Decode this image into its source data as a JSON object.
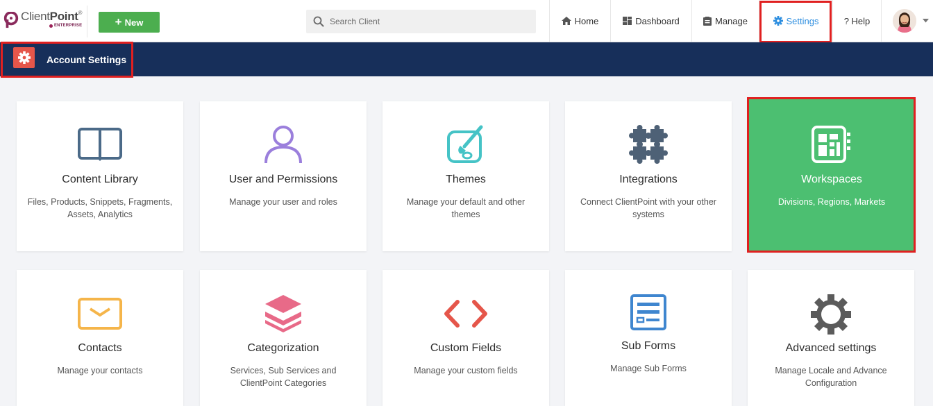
{
  "app": {
    "logo_name_light": "Client",
    "logo_name_bold": "Point",
    "logo_trademark": "®",
    "logo_sub": "ENTERPRISE",
    "new_button": "New",
    "search_placeholder": "Search Client"
  },
  "nav": {
    "home": "Home",
    "dashboard": "Dashboard",
    "manage": "Manage",
    "settings": "Settings",
    "help": "? Help",
    "active": "settings"
  },
  "header": {
    "title": "Account Settings"
  },
  "cards": [
    {
      "id": "content-library",
      "icon": "open-book-icon",
      "title": "Content Library",
      "desc": "Files, Products, Snippets, Fragments, Assets, Analytics"
    },
    {
      "id": "user-permissions",
      "icon": "user-icon",
      "title": "User and Permissions",
      "desc": "Manage your user and roles"
    },
    {
      "id": "themes",
      "icon": "palette-brush-icon",
      "title": "Themes",
      "desc": "Manage your default and other themes"
    },
    {
      "id": "integrations",
      "icon": "puzzle-icon",
      "title": "Integrations",
      "desc": "Connect ClientPoint with your other systems"
    },
    {
      "id": "workspaces",
      "icon": "workspace-grid-icon",
      "title": "Workspaces",
      "desc": "Divisions, Regions, Markets",
      "highlighted": true
    },
    {
      "id": "contacts",
      "icon": "envelope-icon",
      "title": "Contacts",
      "desc": "Manage your contacts"
    },
    {
      "id": "categorization",
      "icon": "layers-icon",
      "title": "Categorization",
      "desc": "Services, Sub Services and ClientPoint Categories"
    },
    {
      "id": "custom-fields",
      "icon": "code-brackets-icon",
      "title": "Custom Fields",
      "desc": "Manage your custom fields"
    },
    {
      "id": "sub-forms",
      "icon": "form-icon",
      "title": "Sub Forms",
      "desc": "Manage Sub Forms"
    },
    {
      "id": "advanced-settings",
      "icon": "cog-icon",
      "title": "Advanced settings",
      "desc": "Manage Locale and Advance Configuration"
    }
  ],
  "colors": {
    "accent_blue": "#2f8fe0",
    "new_green": "#4cae4f",
    "header_navy": "#172f5a",
    "highlight_red": "#e02020",
    "workspace_green": "#4cbf71",
    "gear_box_red": "#e5564a"
  }
}
